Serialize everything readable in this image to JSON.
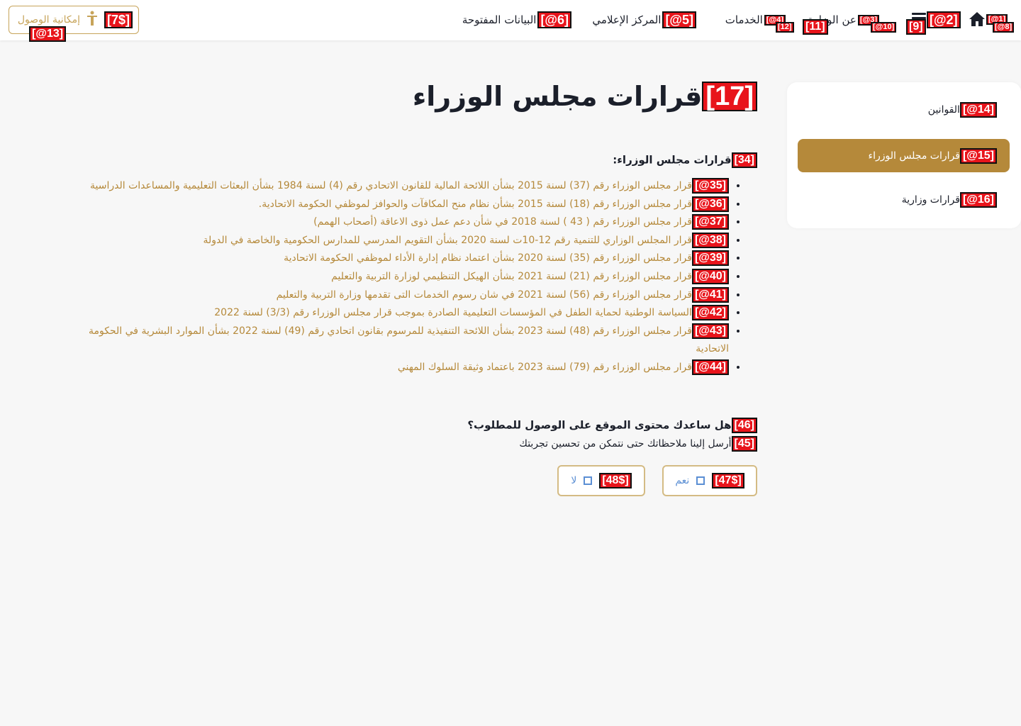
{
  "header": {
    "home": {
      "tag": "[1@]",
      "subtag": "[8@]"
    },
    "menu": {
      "tag": "[2@]",
      "subtag": "[9]"
    },
    "about": {
      "label": "عن الوزارة",
      "tag": "[3@]",
      "subtag": "[10@]",
      "tag2": "[11]"
    },
    "services": {
      "label": "الخدمات",
      "tag": "[4@]",
      "subtag": "[12]"
    },
    "media": {
      "label": "المركز الإعلامي",
      "tag": "[5@]"
    },
    "open_data": {
      "label": "البيانات المفتوحة",
      "tag": "[6@]"
    },
    "accessibility": {
      "label": "إمكانية الوصول",
      "tag": "[7$]",
      "subtag": "[13@]"
    }
  },
  "sidebar": {
    "items": [
      {
        "label": "القوانين",
        "tag": "[14@]"
      },
      {
        "label": "قرارات مجلس الوزراء",
        "tag": "[15@]"
      },
      {
        "label": "قرارات وزارية",
        "tag": "[16@]"
      }
    ]
  },
  "main": {
    "title": "قرارات مجلس الوزراء",
    "title_tag": "[17]",
    "section_heading": "قرارات مجلس الوزراء:",
    "section_tag": "[34]",
    "decisions": [
      {
        "tag": "[35@]",
        "text": "قرار مجلس الوزراء رقم (37) لسنة 2015 بشأن اللائحة المالية للقانون الاتحادي رقم (4) لسنة 1984 بشأن البعثات التعليمية والمساعدات الدراسية"
      },
      {
        "tag": "[36@]",
        "text": "قرار مجلس الوزراء رقم (18) لسنة 2015 بشأن نظام منح المكافآت والحوافز لموظفي الحكومة الاتحادية."
      },
      {
        "tag": "[37@]",
        "text": "قرار مجلس الوزراء رقم ( 43 ) لسنة 2018 في شأن دعم عمل ذوى الاعاقة (أصحاب الهمم)"
      },
      {
        "tag": "[38@]",
        "text": "قرار المجلس الوزاري للتنمية رقم 12-10ت لسنة 2020 بشأن التقويم المدرسي للمدارس الحكومية والخاصة في الدولة"
      },
      {
        "tag": "[39@]",
        "text": "قرار مجلس الوزراء رقم (35) لسنة 2020 بشأن اعتماد نظام إدارة الأداء لموظفي الحكومة الاتحادية"
      },
      {
        "tag": "[40@]",
        "text": "قرار مجلس الوزراء رقم (21) لسنة 2021 بشأن الهيكل التنظيمي لوزارة التربية والتعليم"
      },
      {
        "tag": "[41@]",
        "text": "قرار مجلس الوزراء رقم (56) لسنة 2021 في شان رسوم الخدمات التى تقدمها وزارة التربية والتعليم"
      },
      {
        "tag": "[42@]",
        "text": "السياسة الوطنية لحماية الطفل في المؤسسات التعليمية الصادرة بموجب قرار مجلس الوزراء رقم (3/3) لسنة 2022"
      },
      {
        "tag": "[43@]",
        "text": "قرار مجلس الوزراء رقم (48) لسنة 2023 بشأن اللائحة التنفيذية للمرسوم بقانون اتحادي رقم (49) لسنة 2022 بشأن الموارد البشرية في الحكومة الاتحادية"
      },
      {
        "tag": "[44@]",
        "text": "قرار مجلس الوزراء رقم (79) لسنة 2023 باعتماد وثيقة السلوك المهني"
      }
    ]
  },
  "feedback": {
    "question": "هل ساعدك محتوى الموقع على الوصول للمطلوب؟",
    "question_tag": "[46]",
    "subtitle": "أرسل إلينا ملاحظاتك حتى نتمكن من تحسين تجربتك",
    "subtitle_tag": "[45]",
    "yes": {
      "label": "نعم",
      "tag": "[47$]"
    },
    "no": {
      "label": "لا",
      "tag": "[48$]"
    }
  },
  "colors": {
    "accent": "#b5893a",
    "tag_red": "#e8141b",
    "checkbox_blue": "#5b8fd4"
  }
}
